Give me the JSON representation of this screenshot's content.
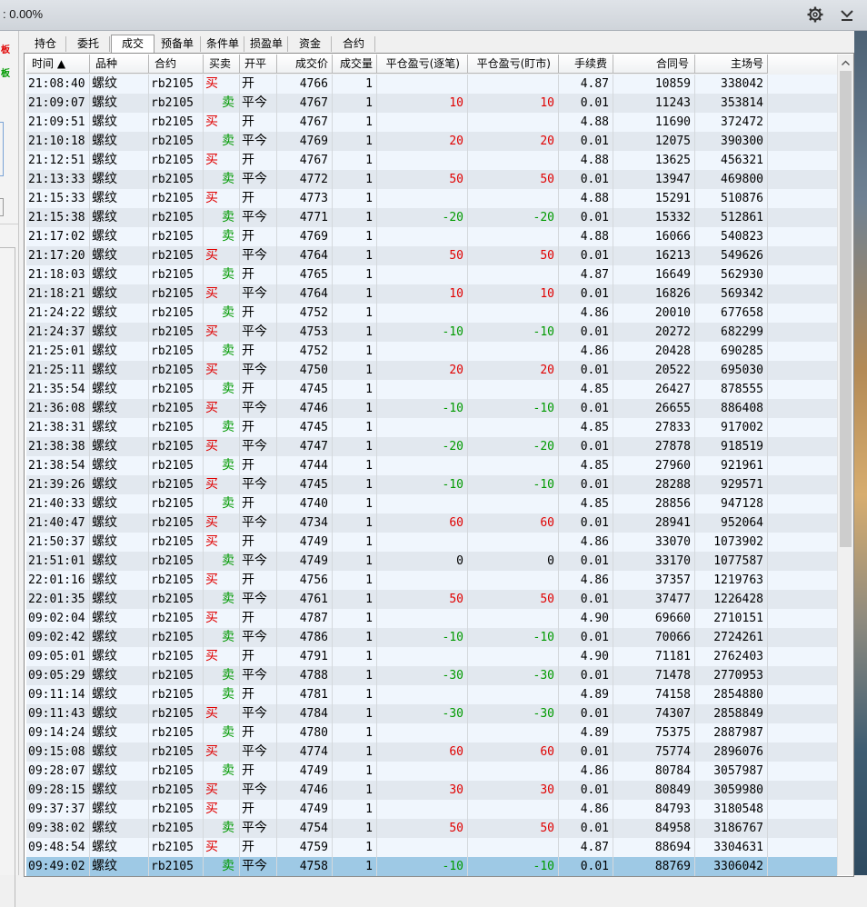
{
  "window": {
    "title": ": 0.00%"
  },
  "left_panel": {
    "mark1": "板",
    "mark2": "板"
  },
  "tabs": [
    {
      "label": "持仓",
      "active": false
    },
    {
      "label": "委托",
      "active": false
    },
    {
      "label": "成交",
      "active": true
    },
    {
      "label": "预备单",
      "active": false
    },
    {
      "label": "条件单",
      "active": false
    },
    {
      "label": "损盈单",
      "active": false
    },
    {
      "label": "资金",
      "active": false
    },
    {
      "label": "合约",
      "active": false
    }
  ],
  "columns": [
    "时间 ▲",
    "品种",
    "合约",
    "买卖",
    "开平",
    "成交价",
    "成交量",
    "平仓盈亏(逐笔)",
    "平仓盈亏(盯市)",
    "手续费",
    "合同号",
    "主场号"
  ],
  "colors": {
    "buy": "#e00000",
    "sell": "#009a00",
    "selected_row": "#9ec9e5"
  },
  "icons": [
    "gear-icon",
    "chevron-down-icon",
    "scroll-up-arrow-icon"
  ],
  "rows": [
    [
      "21:08:40",
      "螺纹",
      "rb2105",
      "买",
      "开",
      "4766",
      "1",
      "",
      "",
      "4.87",
      "10859",
      "338042"
    ],
    [
      "21:09:07",
      "螺纹",
      "rb2105",
      "卖",
      "平今",
      "4767",
      "1",
      "10",
      "10",
      "0.01",
      "11243",
      "353814"
    ],
    [
      "21:09:51",
      "螺纹",
      "rb2105",
      "买",
      "开",
      "4767",
      "1",
      "",
      "",
      "4.88",
      "11690",
      "372472"
    ],
    [
      "21:10:18",
      "螺纹",
      "rb2105",
      "卖",
      "平今",
      "4769",
      "1",
      "20",
      "20",
      "0.01",
      "12075",
      "390300"
    ],
    [
      "21:12:51",
      "螺纹",
      "rb2105",
      "买",
      "开",
      "4767",
      "1",
      "",
      "",
      "4.88",
      "13625",
      "456321"
    ],
    [
      "21:13:33",
      "螺纹",
      "rb2105",
      "卖",
      "平今",
      "4772",
      "1",
      "50",
      "50",
      "0.01",
      "13947",
      "469800"
    ],
    [
      "21:15:33",
      "螺纹",
      "rb2105",
      "买",
      "开",
      "4773",
      "1",
      "",
      "",
      "4.88",
      "15291",
      "510876"
    ],
    [
      "21:15:38",
      "螺纹",
      "rb2105",
      "卖",
      "平今",
      "4771",
      "1",
      "-20",
      "-20",
      "0.01",
      "15332",
      "512861"
    ],
    [
      "21:17:02",
      "螺纹",
      "rb2105",
      "卖",
      "开",
      "4769",
      "1",
      "",
      "",
      "4.88",
      "16066",
      "540823"
    ],
    [
      "21:17:20",
      "螺纹",
      "rb2105",
      "买",
      "平今",
      "4764",
      "1",
      "50",
      "50",
      "0.01",
      "16213",
      "549626"
    ],
    [
      "21:18:03",
      "螺纹",
      "rb2105",
      "卖",
      "开",
      "4765",
      "1",
      "",
      "",
      "4.87",
      "16649",
      "562930"
    ],
    [
      "21:18:21",
      "螺纹",
      "rb2105",
      "买",
      "平今",
      "4764",
      "1",
      "10",
      "10",
      "0.01",
      "16826",
      "569342"
    ],
    [
      "21:24:22",
      "螺纹",
      "rb2105",
      "卖",
      "开",
      "4752",
      "1",
      "",
      "",
      "4.86",
      "20010",
      "677658"
    ],
    [
      "21:24:37",
      "螺纹",
      "rb2105",
      "买",
      "平今",
      "4753",
      "1",
      "-10",
      "-10",
      "0.01",
      "20272",
      "682299"
    ],
    [
      "21:25:01",
      "螺纹",
      "rb2105",
      "卖",
      "开",
      "4752",
      "1",
      "",
      "",
      "4.86",
      "20428",
      "690285"
    ],
    [
      "21:25:11",
      "螺纹",
      "rb2105",
      "买",
      "平今",
      "4750",
      "1",
      "20",
      "20",
      "0.01",
      "20522",
      "695030"
    ],
    [
      "21:35:54",
      "螺纹",
      "rb2105",
      "卖",
      "开",
      "4745",
      "1",
      "",
      "",
      "4.85",
      "26427",
      "878555"
    ],
    [
      "21:36:08",
      "螺纹",
      "rb2105",
      "买",
      "平今",
      "4746",
      "1",
      "-10",
      "-10",
      "0.01",
      "26655",
      "886408"
    ],
    [
      "21:38:31",
      "螺纹",
      "rb2105",
      "卖",
      "开",
      "4745",
      "1",
      "",
      "",
      "4.85",
      "27833",
      "917002"
    ],
    [
      "21:38:38",
      "螺纹",
      "rb2105",
      "买",
      "平今",
      "4747",
      "1",
      "-20",
      "-20",
      "0.01",
      "27878",
      "918519"
    ],
    [
      "21:38:54",
      "螺纹",
      "rb2105",
      "卖",
      "开",
      "4744",
      "1",
      "",
      "",
      "4.85",
      "27960",
      "921961"
    ],
    [
      "21:39:26",
      "螺纹",
      "rb2105",
      "买",
      "平今",
      "4745",
      "1",
      "-10",
      "-10",
      "0.01",
      "28288",
      "929571"
    ],
    [
      "21:40:33",
      "螺纹",
      "rb2105",
      "卖",
      "开",
      "4740",
      "1",
      "",
      "",
      "4.85",
      "28856",
      "947128"
    ],
    [
      "21:40:47",
      "螺纹",
      "rb2105",
      "买",
      "平今",
      "4734",
      "1",
      "60",
      "60",
      "0.01",
      "28941",
      "952064"
    ],
    [
      "21:50:37",
      "螺纹",
      "rb2105",
      "买",
      "开",
      "4749",
      "1",
      "",
      "",
      "4.86",
      "33070",
      "1073902"
    ],
    [
      "21:51:01",
      "螺纹",
      "rb2105",
      "卖",
      "平今",
      "4749",
      "1",
      "0",
      "0",
      "0.01",
      "33170",
      "1077587"
    ],
    [
      "22:01:16",
      "螺纹",
      "rb2105",
      "买",
      "开",
      "4756",
      "1",
      "",
      "",
      "4.86",
      "37357",
      "1219763"
    ],
    [
      "22:01:35",
      "螺纹",
      "rb2105",
      "卖",
      "平今",
      "4761",
      "1",
      "50",
      "50",
      "0.01",
      "37477",
      "1226428"
    ],
    [
      "09:02:04",
      "螺纹",
      "rb2105",
      "买",
      "开",
      "4787",
      "1",
      "",
      "",
      "4.90",
      "69660",
      "2710151"
    ],
    [
      "09:02:42",
      "螺纹",
      "rb2105",
      "卖",
      "平今",
      "4786",
      "1",
      "-10",
      "-10",
      "0.01",
      "70066",
      "2724261"
    ],
    [
      "09:05:01",
      "螺纹",
      "rb2105",
      "买",
      "开",
      "4791",
      "1",
      "",
      "",
      "4.90",
      "71181",
      "2762403"
    ],
    [
      "09:05:29",
      "螺纹",
      "rb2105",
      "卖",
      "平今",
      "4788",
      "1",
      "-30",
      "-30",
      "0.01",
      "71478",
      "2770953"
    ],
    [
      "09:11:14",
      "螺纹",
      "rb2105",
      "卖",
      "开",
      "4781",
      "1",
      "",
      "",
      "4.89",
      "74158",
      "2854880"
    ],
    [
      "09:11:43",
      "螺纹",
      "rb2105",
      "买",
      "平今",
      "4784",
      "1",
      "-30",
      "-30",
      "0.01",
      "74307",
      "2858849"
    ],
    [
      "09:14:24",
      "螺纹",
      "rb2105",
      "卖",
      "开",
      "4780",
      "1",
      "",
      "",
      "4.89",
      "75375",
      "2887987"
    ],
    [
      "09:15:08",
      "螺纹",
      "rb2105",
      "买",
      "平今",
      "4774",
      "1",
      "60",
      "60",
      "0.01",
      "75774",
      "2896076"
    ],
    [
      "09:28:07",
      "螺纹",
      "rb2105",
      "卖",
      "开",
      "4749",
      "1",
      "",
      "",
      "4.86",
      "80784",
      "3057987"
    ],
    [
      "09:28:15",
      "螺纹",
      "rb2105",
      "买",
      "平今",
      "4746",
      "1",
      "30",
      "30",
      "0.01",
      "80849",
      "3059980"
    ],
    [
      "09:37:37",
      "螺纹",
      "rb2105",
      "买",
      "开",
      "4749",
      "1",
      "",
      "",
      "4.86",
      "84793",
      "3180548"
    ],
    [
      "09:38:02",
      "螺纹",
      "rb2105",
      "卖",
      "平今",
      "4754",
      "1",
      "50",
      "50",
      "0.01",
      "84958",
      "3186767"
    ],
    [
      "09:48:54",
      "螺纹",
      "rb2105",
      "买",
      "开",
      "4759",
      "1",
      "",
      "",
      "4.87",
      "88694",
      "3304631"
    ],
    [
      "09:49:02",
      "螺纹",
      "rb2105",
      "卖",
      "平今",
      "4758",
      "1",
      "-10",
      "-10",
      "0.01",
      "88769",
      "3306042"
    ]
  ],
  "selected_row_index": 41
}
